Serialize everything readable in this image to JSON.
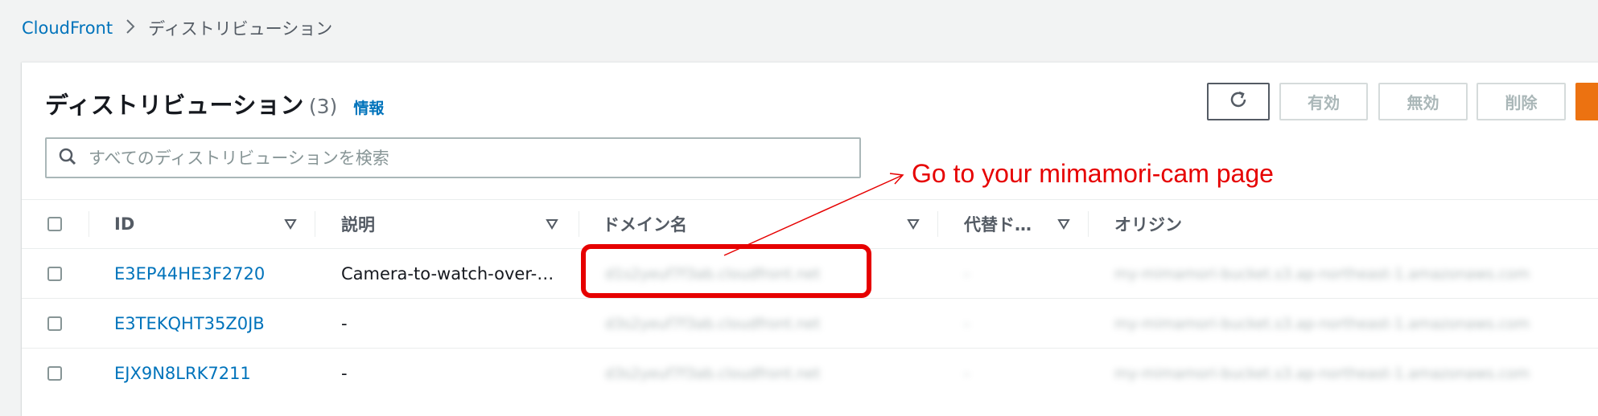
{
  "breadcrumb": {
    "root": "CloudFront",
    "separator_icon": "chevron-right-icon",
    "current": "ディストリビューション"
  },
  "header": {
    "title": "ディストリビューション",
    "count": "(3)",
    "info": "情報"
  },
  "toolbar": {
    "refresh_icon": "refresh-icon",
    "enable_label": "有効",
    "disable_label": "無効",
    "delete_label": "削除",
    "create_label": ""
  },
  "search": {
    "icon": "search-icon",
    "value": "",
    "placeholder": "すべてのディストリビューションを検索"
  },
  "table": {
    "columns": [
      "ID",
      "説明",
      "ドメイン名",
      "代替ド…",
      "オリジン"
    ],
    "rows": [
      {
        "id": "E3EP44HE3F2720",
        "description": "Camera-to-watch-over-…",
        "domain": "d1s2yeuf7f3ab.cloudfront.net",
        "alt": "-",
        "origin": "my-mimamori-bucket.s3.ap-northeast-1.amazonaws.com"
      },
      {
        "id": "E3TEKQHT35Z0JB",
        "description": "-",
        "domain": "d3s2yeuf7f3ab.cloudfront.net",
        "alt": "-",
        "origin": "my-mimamori-bucket.s3.ap-northeast-1.amazonaws.com"
      },
      {
        "id": "EJX9N8LRK7211",
        "description": "-",
        "domain": "d3s2yeuf7f3ab.cloudfront.net",
        "alt": "-",
        "origin": "my-mimamori-bucket.s3.ap-northeast-1.amazonaws.com"
      }
    ]
  },
  "annotation": {
    "text": "Go to your mimamori-cam page",
    "color": "#e60000"
  },
  "colors": {
    "link": "#0073bb",
    "primary_orange": "#ec7211",
    "disabled_text": "#aab7b8"
  }
}
